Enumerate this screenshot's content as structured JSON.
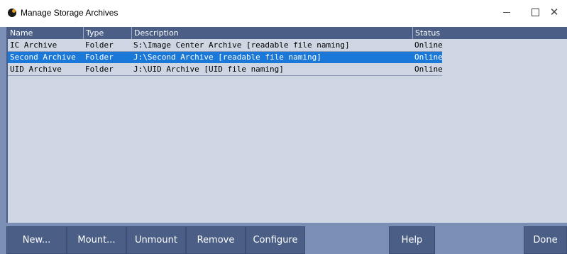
{
  "window": {
    "title": "Manage Storage Archives"
  },
  "columns": [
    "Name",
    "Type",
    "Description",
    "Status"
  ],
  "rows": [
    {
      "name": "IC Archive",
      "type": "Folder",
      "description": "S:\\Image Center Archive [readable file naming]",
      "status": "Online",
      "selected": false
    },
    {
      "name": "Second Archive",
      "type": "Folder",
      "description": "J:\\Second Archive [readable file naming]",
      "status": "Online",
      "selected": true
    },
    {
      "name": "UID Archive",
      "type": "Folder",
      "description": "J:\\UID Archive [UID file naming]",
      "status": "Online",
      "selected": false
    }
  ],
  "buttons": {
    "new": "New...",
    "mount": "Mount...",
    "unmount": "Unmount",
    "remove": "Remove",
    "configure": "Configure",
    "help": "Help",
    "done": "Done"
  },
  "colors": {
    "header": "#4a5e86",
    "selection": "#1a78d8",
    "list_background": "#cdd6e2",
    "frame": "#7b8fb6"
  },
  "icons": {
    "app": "app-logo-icon",
    "minimize": "minimize-icon",
    "maximize": "maximize-icon",
    "close": "close-icon"
  }
}
